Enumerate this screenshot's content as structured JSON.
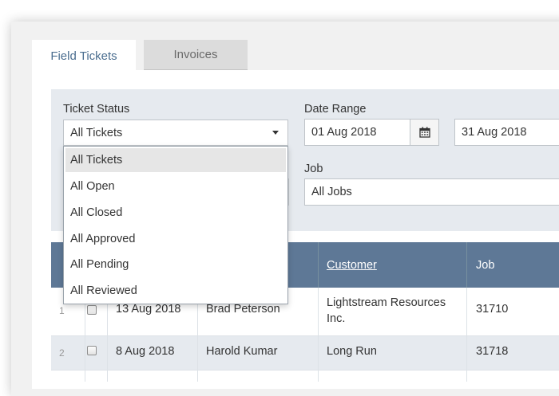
{
  "tabs": [
    {
      "label": "Field Tickets",
      "active": true
    },
    {
      "label": "Invoices",
      "active": false
    }
  ],
  "filters": {
    "ticket_status": {
      "label": "Ticket Status",
      "value": "All Tickets",
      "options": [
        "All Tickets",
        "All Open",
        "All Closed",
        "All Approved",
        "All Pending",
        "All Reviewed"
      ]
    },
    "date_range": {
      "label": "Date Range",
      "from": "01 Aug 2018",
      "to": "31 Aug 2018"
    },
    "job": {
      "label": "Job",
      "value": "All Jobs"
    }
  },
  "table": {
    "headers": {
      "customer": "Customer",
      "job": "Job"
    },
    "rows": [
      {
        "num": "1",
        "date": "13 Aug 2018",
        "person": "Brad Peterson",
        "customer": "Lightstream Resources Inc.",
        "job": "31710"
      },
      {
        "num": "2",
        "date": "8 Aug 2018",
        "person": "Harold Kumar",
        "customer": "Long Run",
        "job": "31718"
      }
    ]
  },
  "icons": {
    "calendar": "calendar-icon",
    "caret": "chevron-down-icon"
  },
  "colors": {
    "header": "#5e7896",
    "filter_bg": "#e6eaef",
    "tab_active_text": "#4a6d8f"
  }
}
